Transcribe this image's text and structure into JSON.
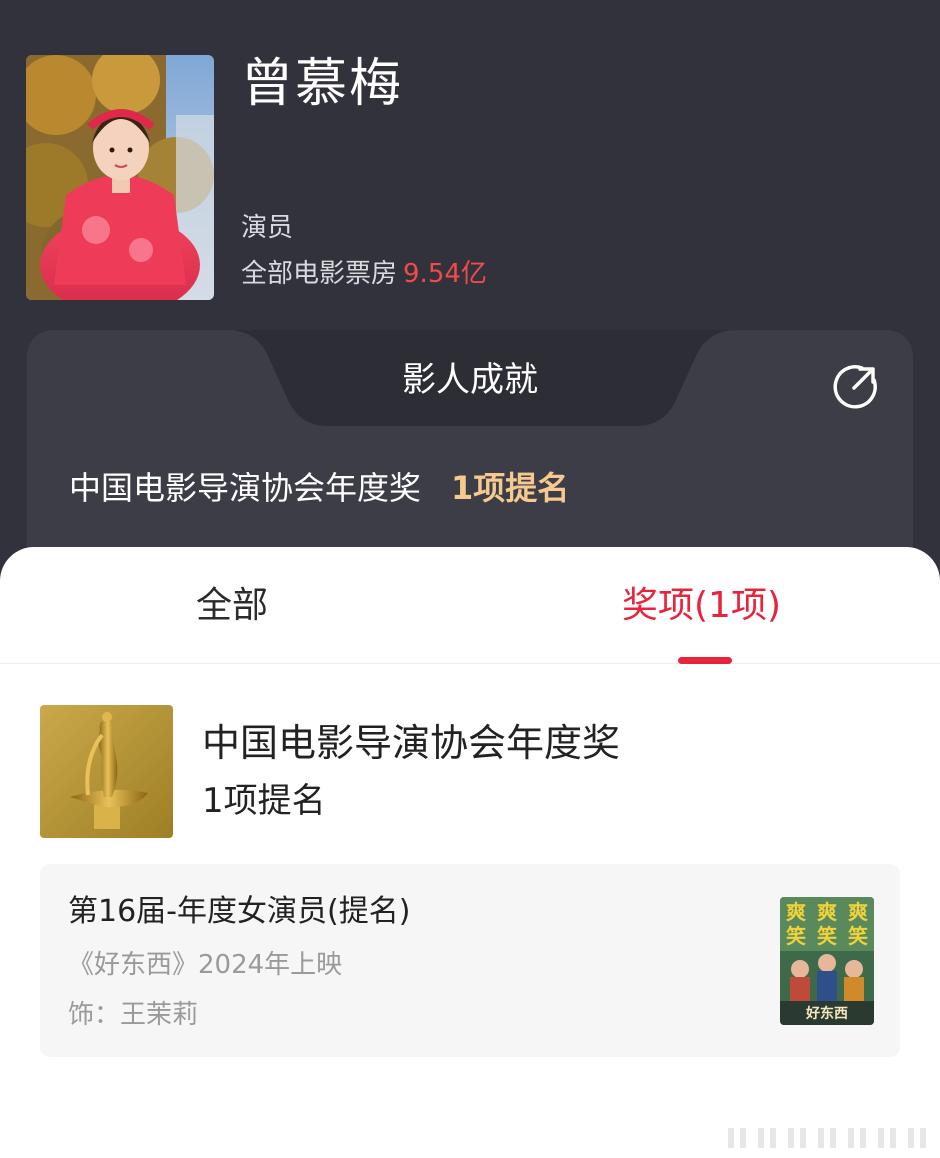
{
  "profile": {
    "name": "曾慕梅",
    "role": "演员",
    "boxoffice_label": "全部电影票房",
    "boxoffice_amount": "9.54亿"
  },
  "achievements": {
    "title": "影人成就",
    "award_name": "中国电影导演协会年度奖",
    "award_count": "1项提名",
    "share_icon": "share-icon"
  },
  "tabs": [
    {
      "label": "全部",
      "active": false
    },
    {
      "label": "奖项(1项)",
      "active": true
    }
  ],
  "award": {
    "name": "中国电影导演协会年度奖",
    "summary": "1项提名",
    "icon": "trophy-statue"
  },
  "nomination": {
    "title": "第16届-年度女演员(提名)",
    "movie": "《好东西》2024年上映",
    "role": "饰：王茉莉",
    "poster_title": "好东西",
    "poster_top_text": "爽爽爽笑笑笑"
  },
  "colors": {
    "accent_red": "#e8243b",
    "amount_red": "#f24a4a",
    "gold": "#f5c98f",
    "dark_bg": "#31323b"
  }
}
